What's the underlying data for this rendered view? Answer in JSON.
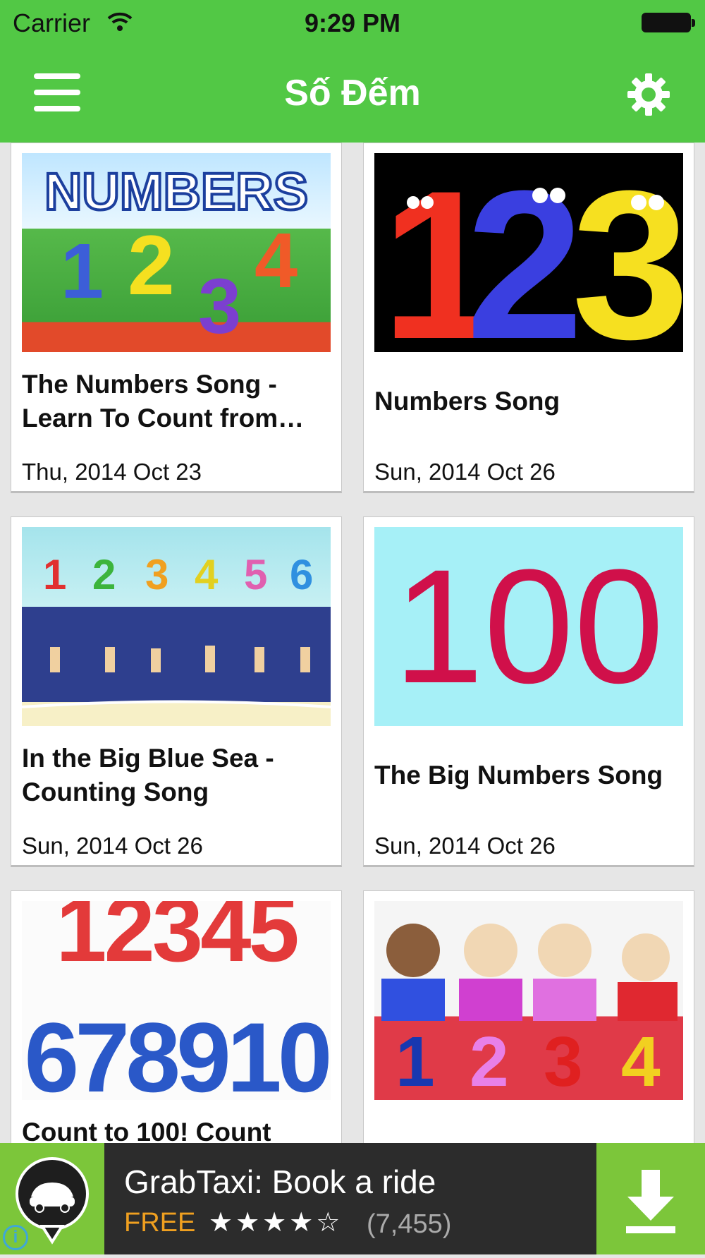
{
  "status_bar": {
    "carrier": "Carrier",
    "time": "9:29 PM"
  },
  "nav": {
    "title": "Số Đếm"
  },
  "videos": [
    {
      "title_line1": "The Numbers Song -",
      "title_line2": "Learn To Count from…",
      "date": "Thu, 2014 Oct 23"
    },
    {
      "title_line1": "Numbers Song",
      "date": "Sun, 2014 Oct 26"
    },
    {
      "title_line1": "In the Big Blue Sea -",
      "title_line2": "Counting Song",
      "date": "Sun, 2014 Oct 26"
    },
    {
      "title_line1": "The Big Numbers Song",
      "date": "Sun, 2014 Oct 26"
    },
    {
      "title_line1": "Count to 100! Count"
    },
    {
      "title_line1": ""
    }
  ],
  "thumbnails": {
    "numbers_heading": "NUMBERS",
    "digits_1_4": [
      "1",
      "2",
      "3",
      "4"
    ],
    "digits_123": [
      "1",
      "2",
      "3"
    ],
    "digits_1_6": [
      "1",
      "2",
      "3",
      "4",
      "5",
      "6"
    ],
    "hundred": "100",
    "clay_row1": "12345",
    "clay_row2": "678910",
    "kids_digits": [
      "1",
      "2",
      "3",
      "4"
    ]
  },
  "ad": {
    "title": "GrabTaxi: Book a ride",
    "price": "FREE",
    "rating_stars": "★★★★☆",
    "rating_count": "(7,455)",
    "info_symbol": "i"
  },
  "colors": {
    "nav_green": "#52c845",
    "ad_green": "#7cc63a",
    "price_orange": "#f0a020"
  }
}
